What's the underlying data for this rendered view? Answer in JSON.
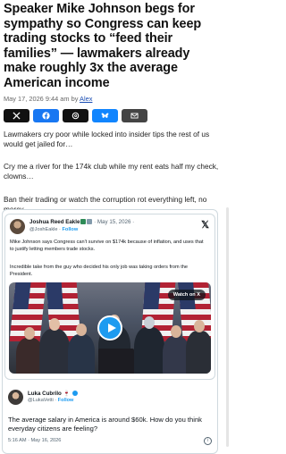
{
  "article": {
    "headline": "Speaker Mike Johnson begs for sympathy so Congress can keep trading stocks to “feed their families” — lawmakers already make roughly 3x the average American income",
    "date": "May 17, 2026 9:44 am by ",
    "author": "Alex"
  },
  "share_buttons": [
    {
      "icon": "x-logo-icon",
      "color": "#111111"
    },
    {
      "icon": "facebook-icon",
      "color": "#1877f2"
    },
    {
      "icon": "threads-icon",
      "color": "#111111"
    },
    {
      "icon": "bluesky-icon",
      "color": "#1185fe"
    },
    {
      "icon": "email-icon",
      "color": "#444444"
    }
  ],
  "paragraphs": [
    "Lawmakers cry poor while locked into insider tips the rest of us would get jailed for…",
    "Cry me a river for the 174k club while my rent eats half my check, clowns…",
    "Ban their trading or watch the corruption rot everything left, no mercy…"
  ],
  "embedded_tweet": {
    "name": "Joshua Reed Eakle",
    "date": " · May 15, 2026 · ",
    "handle": "@JoshEakle",
    "dot": " · ",
    "follow": "Follow",
    "text1": "Mike Johnson says Congress can't survive on $174k because of inflation, and uses that to justify letting members trade stocks.",
    "text2": "Incredible take from the guy who decided his only job was taking orders from the President.",
    "video_label": "Watch on X"
  },
  "reply_tweet": {
    "name": "Luka Cubrilo",
    "emoji": " 🍷",
    "handle": "@LukaVetti",
    "dot": " · ",
    "follow": "Follow",
    "text": "The average salary in America is around $60k. How do you think everyday citizens are feeling?",
    "date": "5:16 AM · May 16, 2026",
    "info": "i"
  }
}
